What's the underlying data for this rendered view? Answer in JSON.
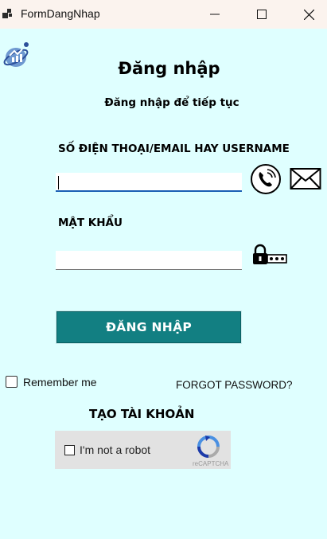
{
  "window": {
    "title": "FormDangNhap",
    "icon": "app-icon",
    "controls": [
      "minimize-icon",
      "maximize-icon",
      "close-icon"
    ]
  },
  "form": {
    "logo": "globe-logo",
    "heading": "Đăng nhập",
    "subheading": "Đăng nhập để tiếp tục",
    "username_label": "SỐ ĐIỆN THOẠI/EMAIL HAY USERNAME",
    "username_value": "",
    "password_label": "MẬT KHẨU",
    "password_value": "",
    "login_button": "ĐĂNG NHẬP",
    "remember_me": "Remember me",
    "remember_checked": false,
    "forgot_password": "FORGOT PASSWORD?",
    "create_account": "TẠO TÀI KHOẢN"
  },
  "captcha": {
    "label": "I'm not a robot",
    "brand": "reCAPTCHA",
    "checked": false
  },
  "colors": {
    "background": "#dfffff",
    "titlebar": "#fbf3ee",
    "login_button": "#127f82"
  }
}
